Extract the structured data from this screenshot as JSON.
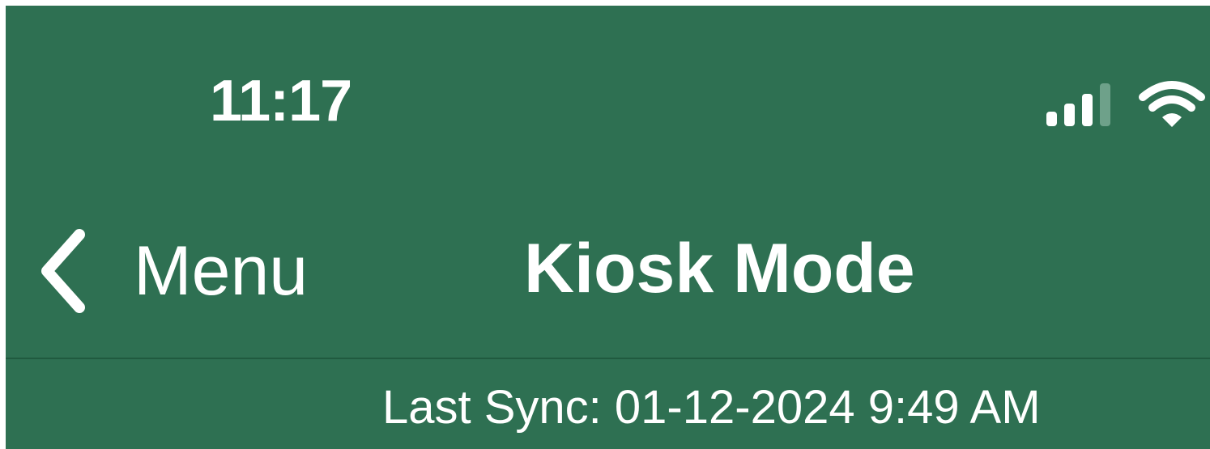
{
  "status_bar": {
    "time": "11:17",
    "signal_icon": "cellular-signal-icon",
    "wifi_icon": "wifi-icon"
  },
  "nav_bar": {
    "back_label": "Menu",
    "back_icon": "chevron-left-icon",
    "title": "Kiosk Mode"
  },
  "sync": {
    "text": "Last Sync: 01-12-2024 9:49 AM"
  },
  "colors": {
    "background": "#2e7052",
    "text": "#ffffff",
    "divider": "#205a3f"
  }
}
